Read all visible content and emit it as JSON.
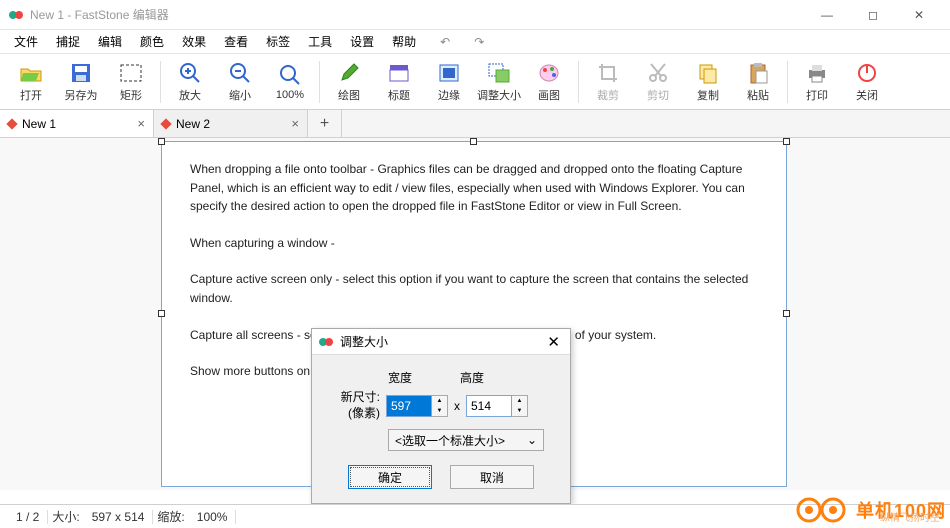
{
  "window": {
    "title": "New 1 - FastStone 编辑器"
  },
  "menu": {
    "items": [
      "文件",
      "捕捉",
      "编辑",
      "颜色",
      "效果",
      "查看",
      "标签",
      "工具",
      "设置",
      "帮助"
    ]
  },
  "toolbar": {
    "open": "打开",
    "saveas": "另存为",
    "rect": "矩形",
    "zoomin": "放大",
    "zoomout": "缩小",
    "zoom100": "100%",
    "draw": "绘图",
    "caption": "标题",
    "edge": "边缘",
    "resize": "调整大小",
    "canvas": "画图",
    "crop": "裁剪",
    "cut": "剪切",
    "copy": "复制",
    "paste": "粘贴",
    "print": "打印",
    "close": "关闭"
  },
  "tabs": {
    "t1": "New 1",
    "t2": "New 2"
  },
  "document": {
    "p1": "When dropping a file onto toolbar - Graphics files can be dragged and dropped onto the floating Capture Panel, which is an efficient way to edit / view files, especially when used with Windows Explorer. You can specify the desired action to open the dropped file in FastStone Editor or view in Full Screen.",
    "p2": "When capturing a window -",
    "p3": "Capture active screen only - select this option if you want to capture the screen that contains the selected window.",
    "p4": "Capture all screens - select this option if you want to capture all screens of your system.",
    "p5": "Show more buttons on toolbar -  If you use Open File in Editor, Screen"
  },
  "dialog": {
    "title": "调整大小",
    "newsize": "新尺寸:",
    "pixels": "(像素)",
    "width_lbl": "宽度",
    "height_lbl": "高度",
    "width": "597",
    "height": "514",
    "x": "x",
    "combo": "<选取一个标准大小>",
    "ok": "确定",
    "cancel": "取消"
  },
  "status": {
    "page": "1 / 2",
    "size_lbl": "大小:",
    "size": "597 x 514",
    "zoom_lbl": "缩放:",
    "zoom": "100%"
  },
  "watermark": {
    "main": "单机100网",
    "sub": "纵情飞扬时空"
  }
}
